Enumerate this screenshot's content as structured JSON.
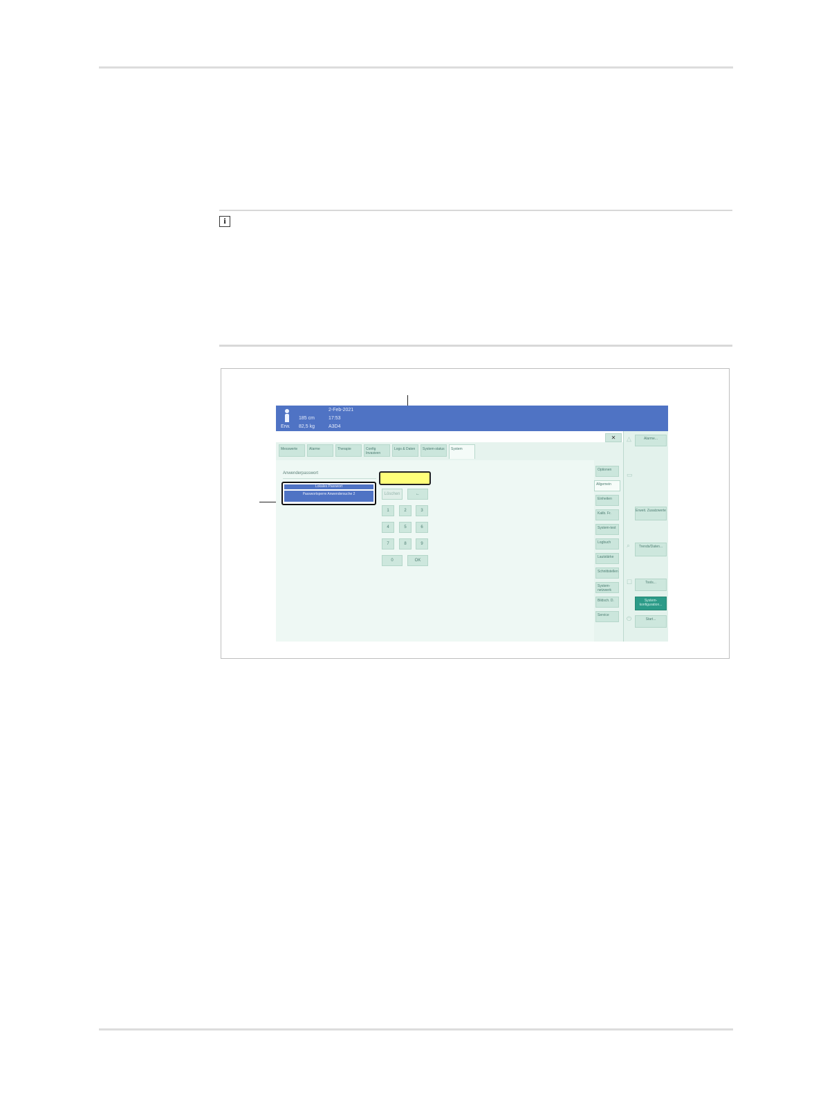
{
  "info_icon": "info-icon",
  "info_glyph": "i",
  "screen": {
    "header": {
      "date": "2-Feb-2021",
      "height": "185 cm",
      "time": "17:53",
      "sex": "Erw.",
      "weight": "82,5 kg",
      "id": "A3D4",
      "icon": "adult-patient-icon"
    },
    "close_glyph": "✕",
    "tabs": [
      {
        "label": "Messwerte"
      },
      {
        "label": "Alarme"
      },
      {
        "label": "Therapie"
      },
      {
        "label": "Config Invasiven"
      },
      {
        "label": "Logs & Daten"
      },
      {
        "label": "System-status"
      },
      {
        "label": "System"
      }
    ],
    "section_title": "Anwenderpasswort",
    "list_items": [
      "Lokales Passwort",
      "Passwortsperre Anwendersuche 2"
    ],
    "keypad": {
      "delete": "Löschen",
      "back": "←",
      "digits": [
        "1",
        "2",
        "3",
        "4",
        "5",
        "6",
        "7",
        "8",
        "9"
      ],
      "zero": "0",
      "ok": "OK"
    },
    "side_tabs": [
      "Optionen",
      "Allgemein",
      "Einheiten",
      "Kalib. Fr.",
      "System-test",
      "Logbuch",
      "Lautstärke",
      "Schnittstellen",
      "System-netzwerk",
      "Bildsch. D.",
      "Service"
    ],
    "right_panel": {
      "alarms": "Alarme...",
      "ecu": "Erweit. Zusatzwerte",
      "trend": "Trends/Daten...",
      "tools": "Tools...",
      "sys_config": "System-konfiguration...",
      "start": "Start..."
    }
  }
}
